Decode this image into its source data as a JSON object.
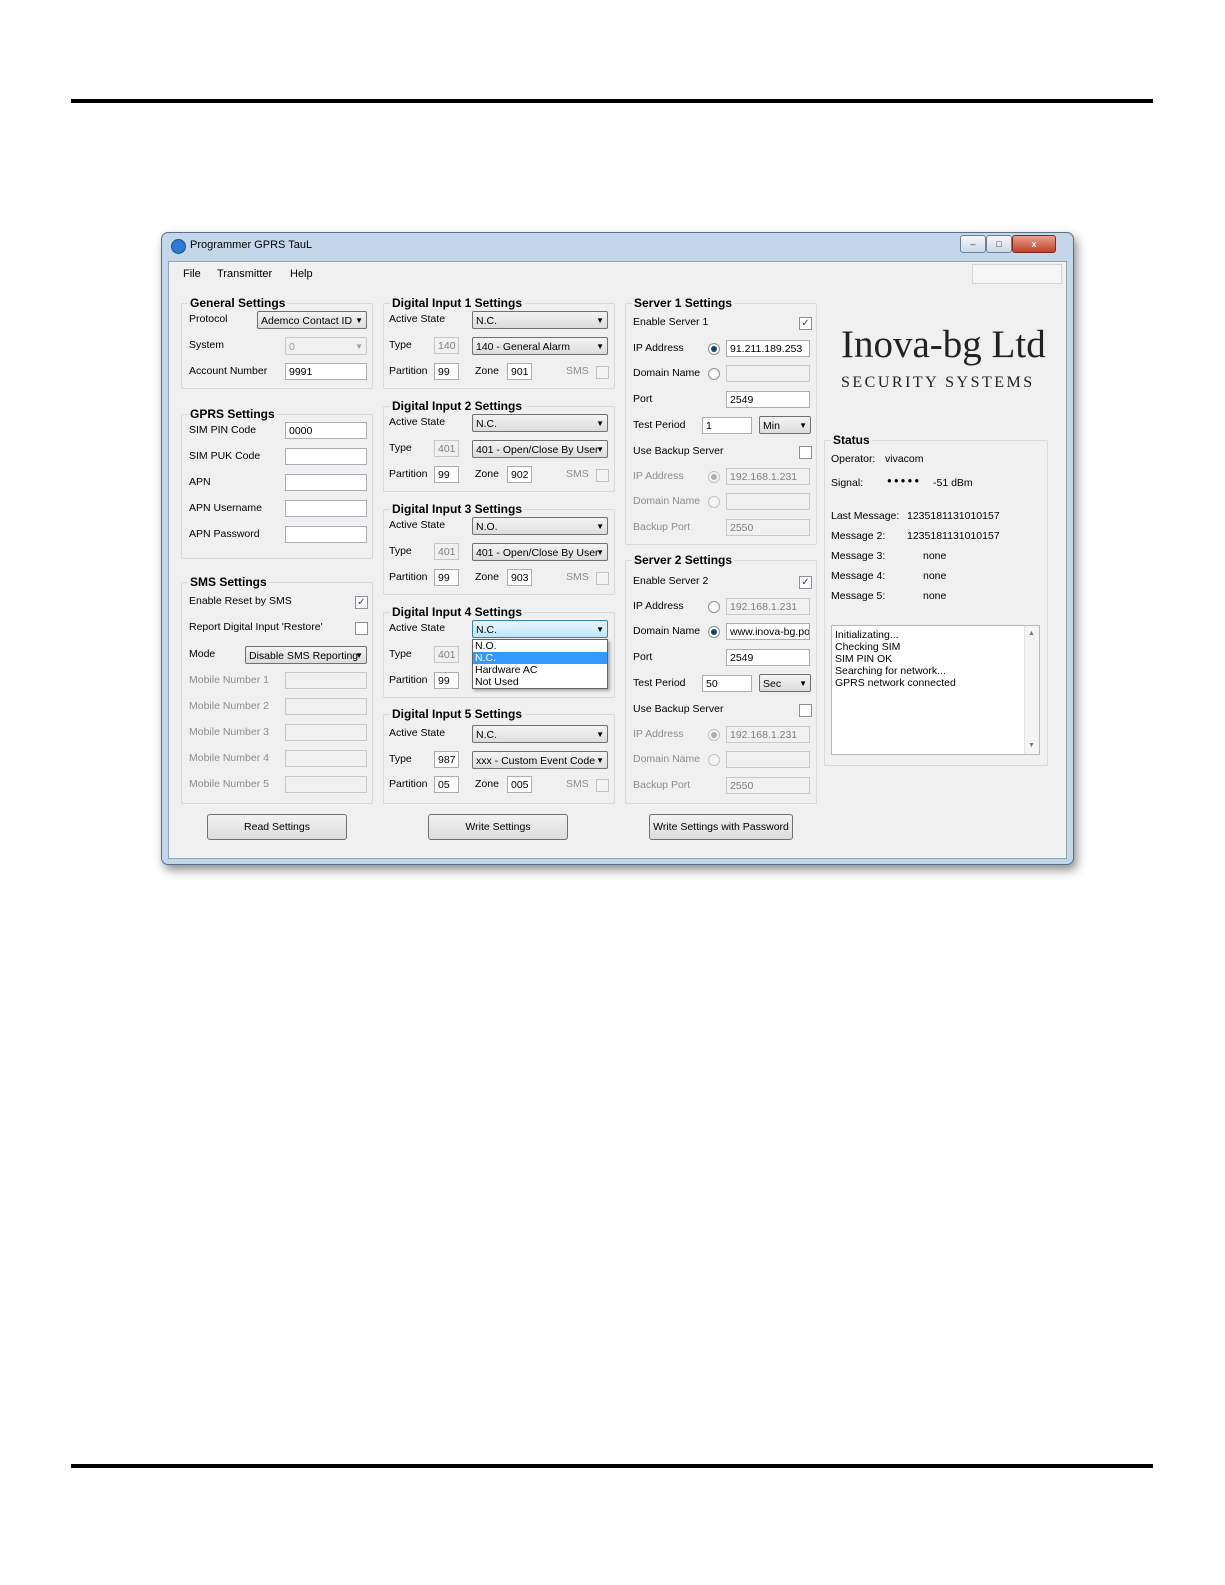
{
  "window": {
    "title": "Programmer GPRS TauL",
    "minimize": "–",
    "maximize": "□",
    "close": "x"
  },
  "menu": [
    "File",
    "Transmitter",
    "Help"
  ],
  "general": {
    "title": "General Settings",
    "protocol_label": "Protocol",
    "protocol_value": "Ademco Contact ID",
    "system_label": "System",
    "system_value": "0",
    "account_label": "Account Number",
    "account_value": "9991"
  },
  "gprs": {
    "title": "GPRS Settings",
    "pin_label": "SIM PIN Code",
    "pin_value": "0000",
    "puk_label": "SIM PUK Code",
    "puk_value": "",
    "apn_label": "APN",
    "apn_value": "",
    "user_label": "APN Username",
    "user_value": "",
    "pass_label": "APN Password",
    "pass_value": ""
  },
  "sms": {
    "title": "SMS Settings",
    "reset_label": "Enable Reset by SMS",
    "reset_checked": "✓",
    "restore_label": "Report Digital Input 'Restore'",
    "restore_checked": "",
    "mode_label": "Mode",
    "mode_value": "Disable SMS Reporting",
    "mobile1_label": "Mobile Number 1",
    "mobile2_label": "Mobile Number 2",
    "mobile3_label": "Mobile Number 3",
    "mobile4_label": "Mobile Number 4",
    "mobile5_label": "Mobile Number 5"
  },
  "din_labels": {
    "active": "Active State",
    "type": "Type",
    "partition": "Partition",
    "zone": "Zone",
    "sms": "SMS"
  },
  "din1": {
    "title": "Digital Input 1 Settings",
    "active": "N.C.",
    "type_code": "140",
    "type": "140 - General Alarm",
    "partition": "99",
    "zone": "901"
  },
  "din2": {
    "title": "Digital Input 2 Settings",
    "active": "N.C.",
    "type_code": "401",
    "type": "401 - Open/Close By User",
    "partition": "99",
    "zone": "902"
  },
  "din3": {
    "title": "Digital Input 3 Settings",
    "active": "N.O.",
    "type_code": "401",
    "type": "401 - Open/Close By User",
    "partition": "99",
    "zone": "903"
  },
  "din4": {
    "title": "Digital Input 4 Settings",
    "active": "N.C.",
    "type_code": "401",
    "partition": "99",
    "options": [
      "N.O.",
      "N.C.",
      "Hardware AC",
      "Not Used"
    ]
  },
  "din5": {
    "title": "Digital Input 5 Settings",
    "active": "N.C.",
    "type_code": "987",
    "type": "xxx - Custom Event Code",
    "partition": "05",
    "zone": "005"
  },
  "srv_labels": {
    "ip": "IP Address",
    "domain": "Domain Name",
    "port": "Port",
    "test": "Test Period",
    "backup": "Use Backup Server",
    "backup_port": "Backup Port"
  },
  "server1": {
    "title": "Server 1 Settings",
    "enable_label": "Enable Server 1",
    "enable_checked": "✓",
    "ip": "91.211.189.253",
    "domain": "",
    "port": "2549",
    "test": "1",
    "test_unit": "Min",
    "backup_ip": "192.168.1.231",
    "backup_domain": "",
    "backup_port": "2550"
  },
  "server2": {
    "title": "Server 2 Settings",
    "enable_label": "Enable Server 2",
    "enable_checked": "✓",
    "ip": "192.168.1.231",
    "domain": "www.inova-bg.pov",
    "port": "2549",
    "test": "50",
    "test_unit": "Sec",
    "backup_ip": "192.168.1.231",
    "backup_domain": "",
    "backup_port": "2550"
  },
  "logo": {
    "line1": "Inova-bg Ltd",
    "line2": "SECURITY  SYSTEMS"
  },
  "status": {
    "title": "Status",
    "operator_label": "Operator:",
    "operator_value": "vivacom",
    "signal_label": "Signal:",
    "signal_dots": "●●●●●",
    "signal_value": "-51 dBm",
    "last_label": "Last Message:",
    "last_value": "1235181131010157",
    "m2_label": "Message 2:",
    "m2_value": "1235181131010157",
    "m3_label": "Message 3:",
    "m3_value": "none",
    "m4_label": "Message 4:",
    "m4_value": "none",
    "m5_label": "Message 5:",
    "m5_value": "none",
    "log": [
      "Initializating...",
      "Checking SIM",
      "SIM PIN OK",
      "Searching for network...",
      "GPRS network connected"
    ]
  },
  "buttons": {
    "read": "Read Settings",
    "write": "Write Settings",
    "write_pwd": "Write Settings with Password"
  }
}
